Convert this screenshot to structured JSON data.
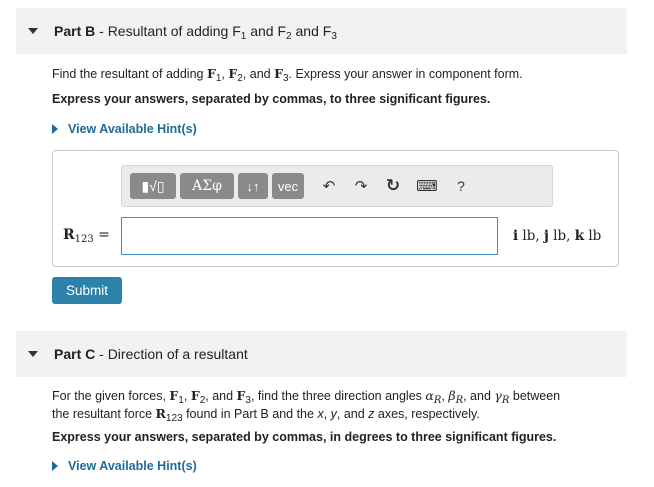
{
  "partB": {
    "label": "Part B",
    "sep": " - ",
    "title_text": "Resultant of adding F",
    "s1": "1",
    "and1": " and F",
    "s2": "2",
    "and2": " and F",
    "s3": "3",
    "instr_pre": "Find the resultant of adding ",
    "f": "F",
    "c": ", ",
    "and": ", and ",
    "instr_post": ". Express your answer in component form.",
    "bold_instruction": "Express your answers, separated by commas, to three significant figures.",
    "hint": "View Available Hint(s)"
  },
  "answer": {
    "var_letter": "R",
    "var_sub": "123",
    "eq": " =",
    "input_value": "",
    "units_i": "i",
    "units_i_tail": " lb, ",
    "units_j": "j",
    "units_j_tail": " lb, ",
    "units_k": "k",
    "units_k_tail": " lb"
  },
  "toolbar": {
    "templates": "▮√▯",
    "greek": "ΑΣφ",
    "arrows": "↓↑",
    "vec": "vec",
    "undo": "↶",
    "redo": "↷",
    "reset": "↻",
    "keyboard": "⌨",
    "help": "?"
  },
  "submit_label": "Submit",
  "partC": {
    "label": "Part C",
    "sep": " - ",
    "title_text": "Direction of a resultant",
    "l1_pre": "For the given forces, ",
    "l1_mid": ", find the three direction angles ",
    "alpha": "α",
    "beta": "β",
    "gamma": "γ",
    "R": "R",
    "l1_end": " between",
    "l2_pre": "the resultant force ",
    "l2_mid": " found in Part B and the ",
    "x": "x",
    "y": "y",
    "z": "z",
    "l2_end": " axes, respectively.",
    "bold_instruction": "Express your answers, separated by commas, in degrees to three significant figures.",
    "hint": "View Available Hint(s)"
  }
}
